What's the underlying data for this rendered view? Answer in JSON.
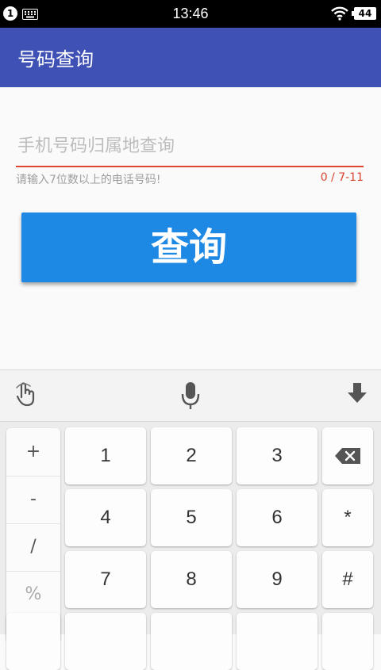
{
  "status_bar": {
    "notification_count": "1",
    "time": "13:46",
    "battery": "44",
    "icons": [
      "notification-badge",
      "keyboard-icon",
      "wifi-icon",
      "battery-icon"
    ]
  },
  "app_bar": {
    "title": "号码查询",
    "color": "#3f51b5"
  },
  "form": {
    "phone_placeholder": "手机号码归属地查询",
    "phone_value": "",
    "helper_text": "请输入7位数以上的电话号码!",
    "counter": "0 / 7-11",
    "query_button": "查询",
    "button_color": "#1e88e5",
    "underline_color": "#e0452f"
  },
  "keyboard": {
    "toolbar_icons": [
      "gesture-icon",
      "microphone-icon",
      "hide-keyboard-icon"
    ],
    "symbols": [
      "+",
      "-",
      "/",
      "%"
    ],
    "digits": [
      [
        "1",
        "2",
        "3"
      ],
      [
        "4",
        "5",
        "6"
      ],
      [
        "7",
        "8",
        "9"
      ]
    ],
    "side_keys": [
      "backspace-icon",
      "*",
      "#"
    ]
  }
}
